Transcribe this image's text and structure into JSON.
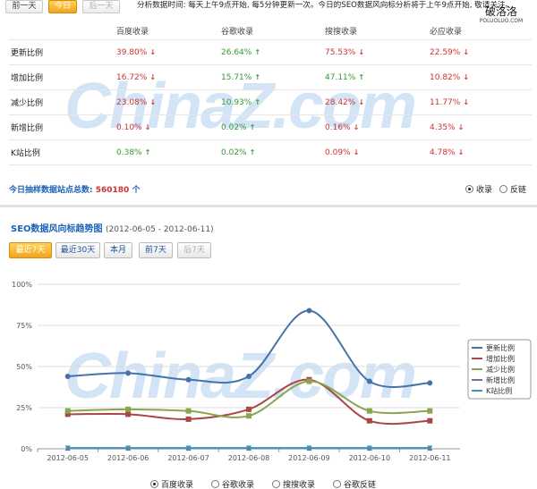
{
  "toolbar": {
    "prev_day": "前一天",
    "today": "今日",
    "next_day": "后一天",
    "info": "分析数据时间: 每天上午9点开始, 每5分钟更新一次。今日的SEO数据风向标分析将于上午9点开始, 敬请关注。"
  },
  "watermark": {
    "site_name": "破洛洛",
    "site_url": "POLUOLUO.COM",
    "bg_text": "ChinaZ.com"
  },
  "table": {
    "headers": [
      "",
      "百度收录",
      "谷歌收录",
      "搜搜收录",
      "必应收录"
    ],
    "rows": [
      {
        "label": "更新比例",
        "cells": [
          {
            "v": "39.80%",
            "d": "down"
          },
          {
            "v": "26.64%",
            "d": "up"
          },
          {
            "v": "75.53%",
            "d": "down"
          },
          {
            "v": "22.59%",
            "d": "down"
          }
        ]
      },
      {
        "label": "增加比例",
        "cells": [
          {
            "v": "16.72%",
            "d": "down"
          },
          {
            "v": "15.71%",
            "d": "up"
          },
          {
            "v": "47.11%",
            "d": "up"
          },
          {
            "v": "10.82%",
            "d": "down"
          }
        ]
      },
      {
        "label": "减少比例",
        "cells": [
          {
            "v": "23.08%",
            "d": "down"
          },
          {
            "v": "10.93%",
            "d": "up"
          },
          {
            "v": "28.42%",
            "d": "down"
          },
          {
            "v": "11.77%",
            "d": "down"
          }
        ]
      },
      {
        "label": "新增比例",
        "cells": [
          {
            "v": "0.10%",
            "d": "down"
          },
          {
            "v": "0.02%",
            "d": "up"
          },
          {
            "v": "0.16%",
            "d": "down"
          },
          {
            "v": "4.35%",
            "d": "down"
          }
        ]
      },
      {
        "label": "K站比例",
        "cells": [
          {
            "v": "0.38%",
            "d": "up"
          },
          {
            "v": "0.02%",
            "d": "up"
          },
          {
            "v": "0.09%",
            "d": "down"
          },
          {
            "v": "4.78%",
            "d": "down"
          }
        ]
      }
    ]
  },
  "summary": {
    "label": "今日抽样数据站点总数:",
    "count": "560180",
    "unit": "个"
  },
  "top_radios": {
    "opt1": "收录",
    "opt2": "反链"
  },
  "trend": {
    "title": "SEO数据风向标趋势图",
    "range": "(2012-06-05 - 2012-06-11)",
    "buttons": [
      "最近7天",
      "最近30天",
      "本月",
      "前7天",
      "后7天"
    ]
  },
  "bottom_radios": [
    "百度收录",
    "谷歌收录",
    "搜搜收录",
    "谷歌反链"
  ],
  "colors": {
    "accent": "#1b62b8",
    "up": "#339933",
    "down": "#cc3333",
    "active_button": "#f3a41c"
  },
  "chart_data": {
    "type": "line",
    "x": [
      "2012-06-05",
      "2012-06-06",
      "2012-06-07",
      "2012-06-08",
      "2012-06-09",
      "2012-06-10",
      "2012-06-11"
    ],
    "ylim": [
      0,
      100
    ],
    "yticks": [
      "0%",
      "25%",
      "50%",
      "75%",
      "100%"
    ],
    "grid": true,
    "legend_position": "right",
    "series": [
      {
        "name": "更新比例",
        "color": "#4572a7",
        "marker": "circle",
        "values": [
          44,
          46,
          42,
          44,
          84,
          41,
          40
        ]
      },
      {
        "name": "增加比例",
        "color": "#aa4643",
        "marker": "square",
        "values": [
          21,
          21,
          18,
          24,
          42,
          17,
          17
        ]
      },
      {
        "name": "减少比例",
        "color": "#89a54e",
        "marker": "square",
        "values": [
          23,
          24,
          23,
          20,
          41,
          23,
          23
        ]
      },
      {
        "name": "新增比例",
        "color": "#80699b",
        "marker": "triangle",
        "values": [
          0.5,
          0.5,
          0.5,
          0.5,
          0.5,
          0.5,
          0.5
        ]
      },
      {
        "name": "K站比例",
        "color": "#3d96ae",
        "marker": "triangle-down",
        "values": [
          0.3,
          0.3,
          0.3,
          0.3,
          0.3,
          0.3,
          0.3
        ]
      }
    ]
  }
}
